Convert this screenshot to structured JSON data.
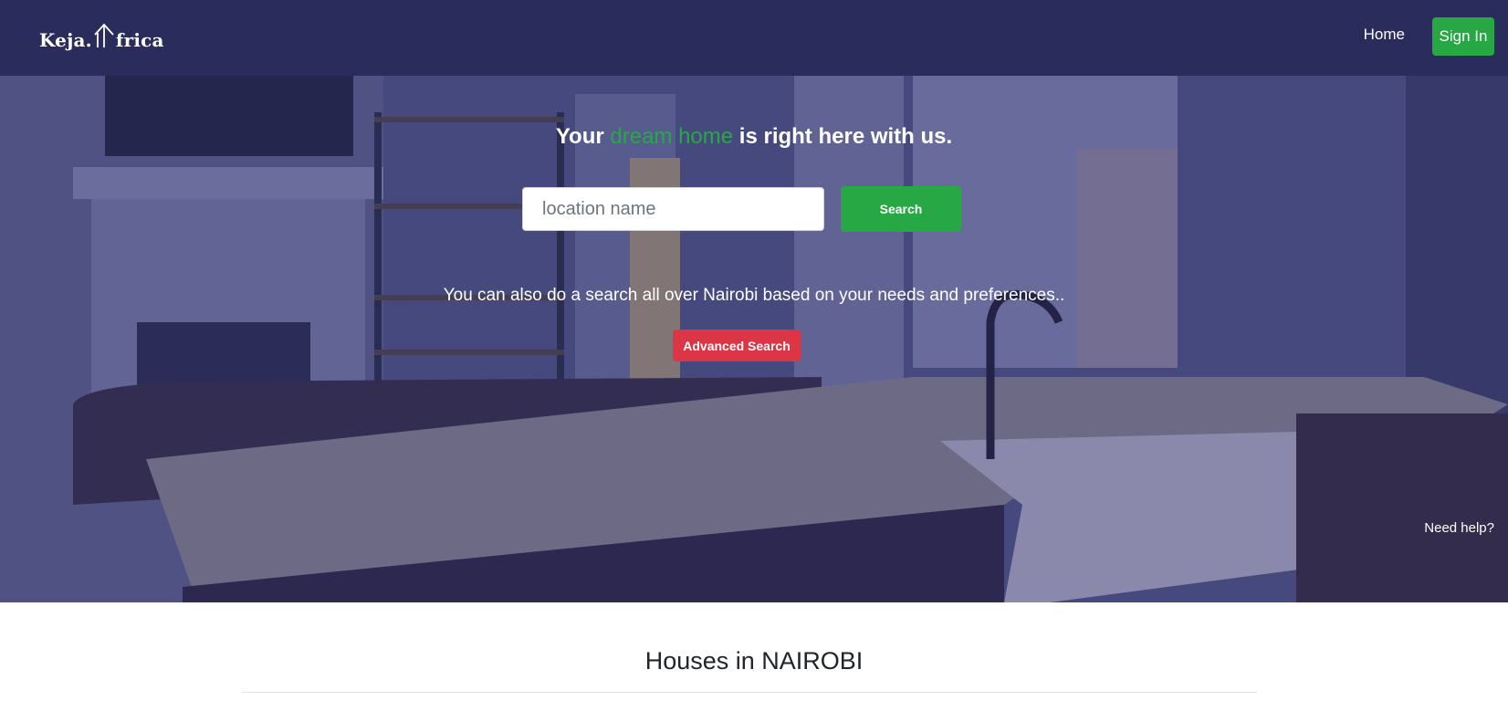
{
  "navbar": {
    "logo_text_left": "Keja.",
    "logo_text_right": "frica",
    "home_label": "Home",
    "signin_label": "Sign In"
  },
  "hero": {
    "title_before": "Your ",
    "title_accent": "dream home",
    "title_after": " is right here with us.",
    "search_placeholder": "location name",
    "search_value": "",
    "search_button_label": "Search",
    "subtitle": "You can also do a search all over Nairobi based on your needs and preferences..",
    "advanced_button_label": "Advanced Search",
    "need_help_label": "Need help?"
  },
  "section": {
    "title": "Houses in NAIROBI"
  },
  "colors": {
    "navbar_bg": "#2a2c5b",
    "accent_green": "#28a745",
    "accent_red": "#dc3545"
  },
  "icons": {
    "logo": "house-outline-icon"
  }
}
